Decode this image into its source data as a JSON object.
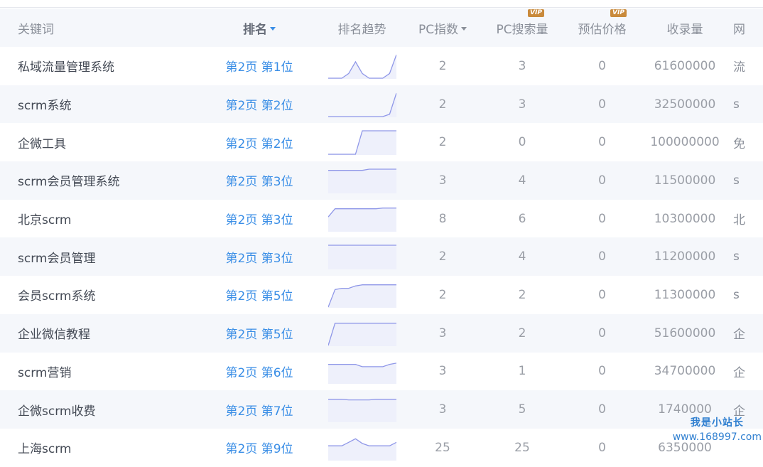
{
  "header": {
    "keyword": "关键词",
    "rank": "排名",
    "trend": "排名趋势",
    "pc_index": "PC指数",
    "pc_search": "PC搜索量",
    "est_price": "预估价格",
    "indexed": "收录量",
    "more": "网",
    "vip": "VIP"
  },
  "rows": [
    {
      "keyword": "私域流量管理系统",
      "rank": "第2页 第1位",
      "pc_index": "2",
      "pc_search": "3",
      "price": "0",
      "indexed": "61600000",
      "more": "流",
      "trend": [
        0,
        0,
        0,
        0.2,
        0.7,
        0.2,
        0,
        0,
        0,
        0.2,
        1
      ]
    },
    {
      "keyword": "scrm系统",
      "rank": "第2页 第2位",
      "pc_index": "2",
      "pc_search": "3",
      "price": "0",
      "indexed": "32500000",
      "more": "s",
      "trend": [
        0,
        0,
        0,
        0,
        0,
        0,
        0,
        0,
        0,
        0.1,
        1
      ]
    },
    {
      "keyword": "企微工具",
      "rank": "第2页 第2位",
      "pc_index": "2",
      "pc_search": "0",
      "price": "0",
      "indexed": "100000000",
      "more": "免",
      "trend": [
        0,
        0,
        0,
        0,
        0,
        1,
        1,
        1,
        1,
        1,
        1
      ]
    },
    {
      "keyword": "scrm会员管理系统",
      "rank": "第2页 第3位",
      "pc_index": "3",
      "pc_search": "4",
      "price": "0",
      "indexed": "11500000",
      "more": "s",
      "trend": [
        0.95,
        0.95,
        0.95,
        0.95,
        0.95,
        0.95,
        1,
        1,
        1,
        1,
        1
      ]
    },
    {
      "keyword": "北京scrm",
      "rank": "第2页 第3位",
      "pc_index": "8",
      "pc_search": "6",
      "price": "0",
      "indexed": "10300000",
      "more": "北",
      "trend": [
        0.6,
        0.95,
        0.95,
        0.95,
        0.95,
        0.95,
        0.95,
        0.95,
        0.98,
        0.98,
        0.98
      ]
    },
    {
      "keyword": "scrm会员管理",
      "rank": "第2页 第3位",
      "pc_index": "2",
      "pc_search": "4",
      "price": "0",
      "indexed": "11200000",
      "more": "s",
      "trend": [
        1,
        1,
        1,
        1,
        1,
        1,
        1,
        1,
        1,
        1,
        1
      ]
    },
    {
      "keyword": "会员scrm系统",
      "rank": "第2页 第5位",
      "pc_index": "2",
      "pc_search": "2",
      "price": "0",
      "indexed": "11300000",
      "more": "s",
      "trend": [
        0,
        0.75,
        0.8,
        0.8,
        0.9,
        0.95,
        0.95,
        0.95,
        0.95,
        0.95,
        0.95
      ]
    },
    {
      "keyword": "企业微信教程",
      "rank": "第2页 第5位",
      "pc_index": "3",
      "pc_search": "2",
      "price": "0",
      "indexed": "51600000",
      "more": "企",
      "trend": [
        0,
        0.95,
        0.95,
        0.95,
        0.95,
        0.95,
        0.95,
        0.95,
        0.95,
        0.95,
        0.95
      ]
    },
    {
      "keyword": "scrm营销",
      "rank": "第2页 第6位",
      "pc_index": "3",
      "pc_search": "1",
      "price": "0",
      "indexed": "34700000",
      "more": "企",
      "trend": [
        0.8,
        0.8,
        0.8,
        0.8,
        0.8,
        0.7,
        0.7,
        0.7,
        0.7,
        0.8,
        0.85
      ]
    },
    {
      "keyword": "企微scrm收费",
      "rank": "第2页 第7位",
      "pc_index": "3",
      "pc_search": "5",
      "price": "0",
      "indexed": "1740000",
      "more": "企",
      "trend": [
        0.95,
        0.95,
        0.95,
        0.92,
        0.92,
        0.92,
        0.92,
        0.95,
        0.95,
        0.95,
        0.95
      ]
    },
    {
      "keyword": "上海scrm",
      "rank": "第2页 第9位",
      "pc_index": "25",
      "pc_search": "25",
      "price": "0",
      "indexed": "6350000",
      "more": "",
      "trend": [
        0.6,
        0.6,
        0.6,
        0.75,
        0.9,
        0.7,
        0.6,
        0.6,
        0.6,
        0.6,
        0.75
      ]
    }
  ],
  "watermark": {
    "title": "我是小站长",
    "url": "www.168997.com"
  },
  "colors": {
    "rank_link": "#3a8ee6",
    "sparkline": "#8f97e8",
    "vip_badge": "#c98a3b"
  }
}
